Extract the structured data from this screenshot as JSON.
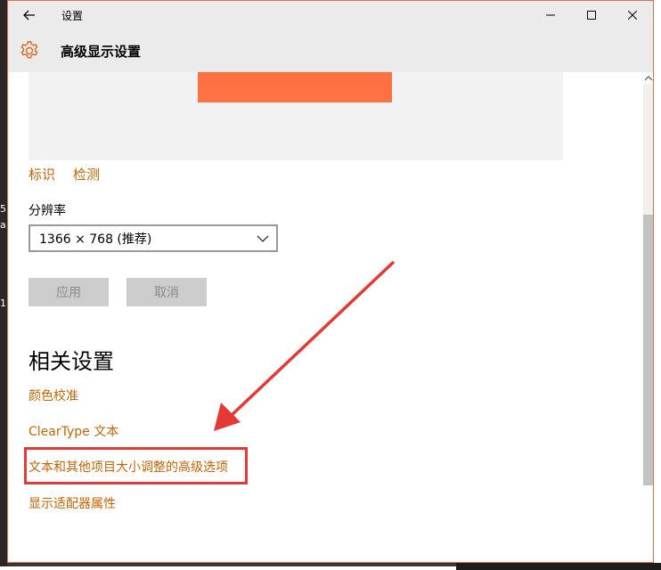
{
  "window": {
    "title": "设置",
    "page_title": "高级显示设置"
  },
  "display": {
    "identify_label": "标识",
    "detect_label": "检测",
    "resolution_label": "分辨率",
    "resolution_value": "1366 × 768 (推荐)",
    "apply_label": "应用",
    "cancel_label": "取消"
  },
  "related": {
    "section_title": "相关设置",
    "items": [
      "颜色校准",
      "ClearType 文本",
      "文本和其他项目大小调整的高级选项",
      "显示适配器属性"
    ]
  },
  "background_fragments": {
    "left_1": "5",
    "left_2": "a",
    "left_3": "1"
  },
  "colors": {
    "accent_link": "#c86400",
    "monitor_preview": "#ff7043",
    "annotation_red": "#e53935"
  },
  "icons": {
    "back": "back-arrow-icon",
    "settings": "gear-icon",
    "minimize": "minimize-icon",
    "maximize": "maximize-icon",
    "close": "close-icon",
    "dropdown": "chevron-down-icon"
  }
}
